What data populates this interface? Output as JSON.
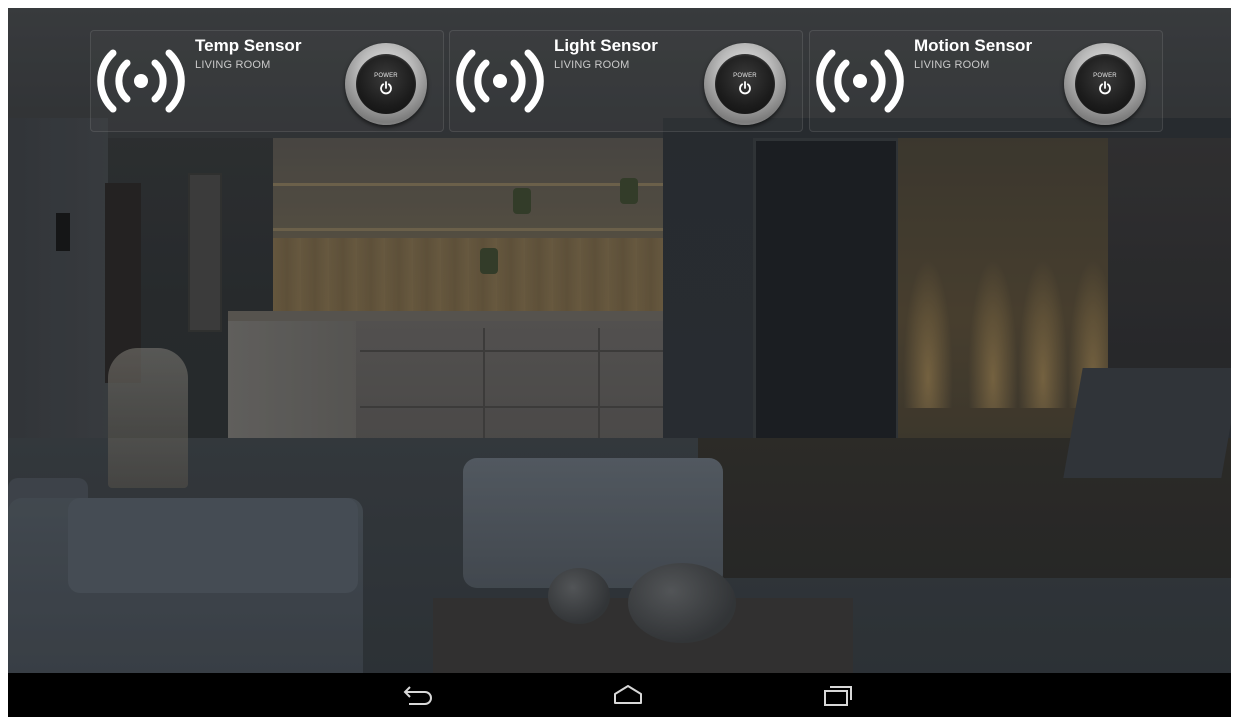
{
  "sensors": [
    {
      "title": "Temp Sensor",
      "location": "LIVING ROOM",
      "power_label": "POWER",
      "icon": "wireless-signal-icon"
    },
    {
      "title": "Light Sensor",
      "location": "LIVING ROOM",
      "power_label": "POWER",
      "icon": "wireless-signal-icon"
    },
    {
      "title": "Motion Sensor",
      "location": "LIVING ROOM",
      "power_label": "POWER",
      "icon": "wireless-signal-icon"
    }
  ],
  "navbar": {
    "buttons": [
      "back-icon",
      "home-icon",
      "recent-apps-icon"
    ]
  },
  "colors": {
    "card_title": "#ffffff",
    "card_subtitle": "#c9c9c9",
    "navbar": "#000000"
  }
}
